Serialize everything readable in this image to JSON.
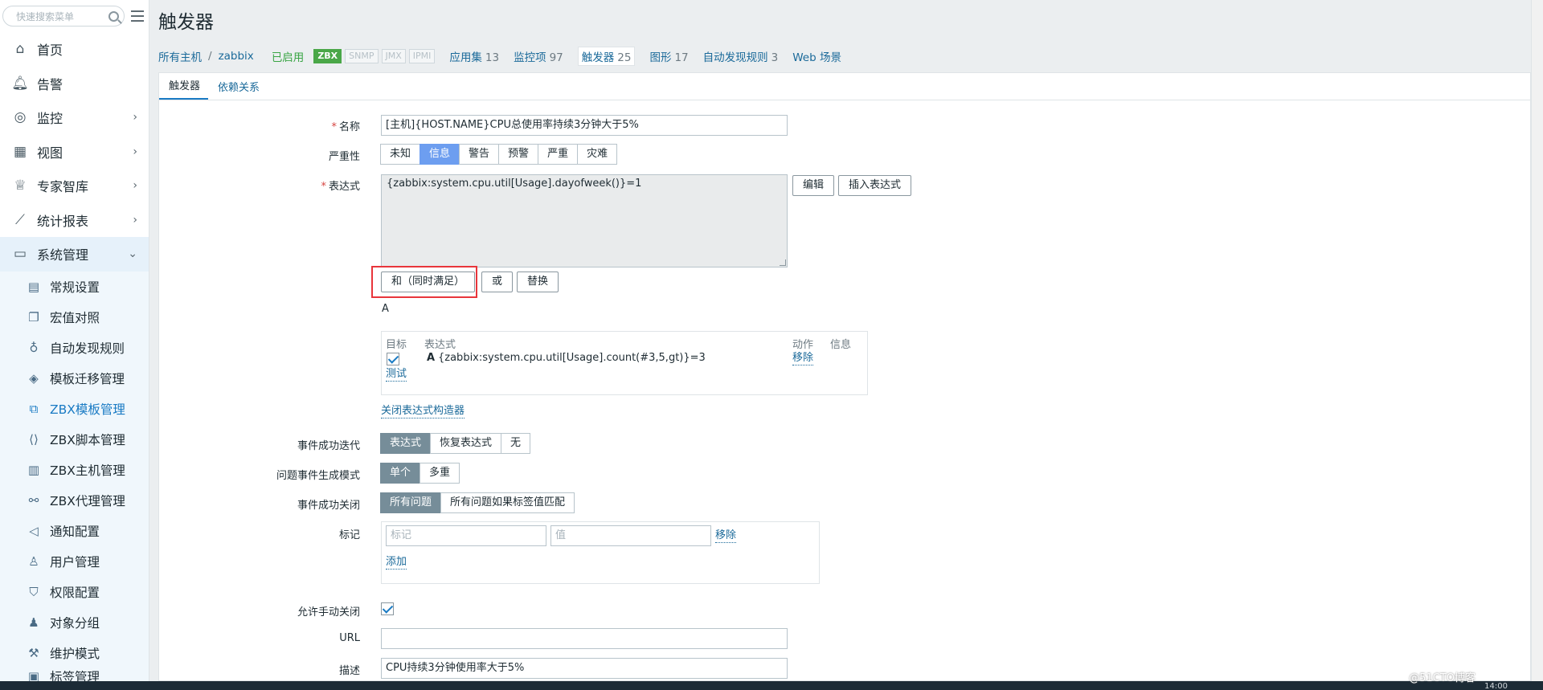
{
  "search": {
    "placeholder": "快速搜索菜单"
  },
  "menu": {
    "items": [
      {
        "label": "首页",
        "icon": "home-icon"
      },
      {
        "label": "告警",
        "icon": "bell-icon"
      },
      {
        "label": "监控",
        "icon": "monitor-eye-icon",
        "arrow": "›"
      },
      {
        "label": "视图",
        "icon": "grid-icon",
        "arrow": "›"
      },
      {
        "label": "专家智库",
        "icon": "graduation-cap-icon",
        "arrow": "›"
      },
      {
        "label": "统计报表",
        "icon": "line-chart-icon",
        "arrow": "›"
      },
      {
        "label": "系统管理",
        "icon": "desktop-icon",
        "arrow": "⌄"
      }
    ],
    "sub_items": [
      {
        "label": "常规设置",
        "icon": "calendar-icon"
      },
      {
        "label": "宏值对照",
        "icon": "copy-icon"
      },
      {
        "label": "自动发现规则",
        "icon": "bulb-icon"
      },
      {
        "label": "模板迁移管理",
        "icon": "layers-icon"
      },
      {
        "label": "ZBX模板管理",
        "icon": "template-icon"
      },
      {
        "label": "ZBX脚本管理",
        "icon": "code-file-icon"
      },
      {
        "label": "ZBX主机管理",
        "icon": "server-icon"
      },
      {
        "label": "ZBX代理管理",
        "icon": "network-icon"
      },
      {
        "label": "通知配置",
        "icon": "speaker-icon"
      },
      {
        "label": "用户管理",
        "icon": "user-icon"
      },
      {
        "label": "权限配置",
        "icon": "shield-icon"
      },
      {
        "label": "对象分组",
        "icon": "group-icon"
      },
      {
        "label": "维护模式",
        "icon": "tools-icon"
      },
      {
        "label": "标签管理",
        "icon": "tag-icon"
      }
    ]
  },
  "page": {
    "title": "触发器"
  },
  "breadcrumb": {
    "all_hosts": "所有主机",
    "separator": "/",
    "host": "zabbix",
    "status": "已启用"
  },
  "badges": {
    "zbx": "ZBX",
    "snmp": "SNMP",
    "jmx": "JMX",
    "ipmi": "IPMI"
  },
  "nav_links": [
    {
      "label": "应用集",
      "count": "13"
    },
    {
      "label": "监控项",
      "count": "97"
    },
    {
      "label": "触发器",
      "count": "25"
    },
    {
      "label": "图形",
      "count": "17"
    },
    {
      "label": "自动发现规则",
      "count": "3"
    },
    {
      "label": "Web 场景",
      "count": ""
    }
  ],
  "tabs": {
    "trigger": "触发器",
    "dependencies": "依赖关系"
  },
  "form": {
    "name_label": "名称",
    "name_value": "[主机]{HOST.NAME}CPU总使用率持续3分钟大于5%",
    "severity_label": "严重性",
    "severity_options": [
      "未知",
      "信息",
      "警告",
      "预警",
      "严重",
      "灾难"
    ],
    "expression_label": "表达式",
    "expression_value": "{zabbix:system.cpu.util[Usage].dayofweek()}=1",
    "edit_button": "编辑",
    "insert_expression_button": "插入表达式",
    "and_button": "和（同时满足）",
    "or_button": "或",
    "replace_button": "替换",
    "expr_letter": "A",
    "builder": {
      "col_target": "目标",
      "col_expression": "表达式",
      "col_action": "动作",
      "col_info": "信息",
      "row_letter": "A",
      "row_expression": "{zabbix:system.cpu.util[Usage].count(#3,5,gt)}=3",
      "remove_link": "移除",
      "test_link": "测试"
    },
    "close_builder_link": "关闭表达式构造器",
    "ok_event_gen_label": "事件成功迭代",
    "ok_event_gen_options": [
      "表达式",
      "恢复表达式",
      "无"
    ],
    "problem_mode_label": "问题事件生成模式",
    "problem_mode_options": [
      "单个",
      "多重"
    ],
    "ok_close_label": "事件成功关闭",
    "ok_close_options": [
      "所有问题",
      "所有问题如果标签值匹配"
    ],
    "tags_label": "标记",
    "tag_placeholder": "标记",
    "value_placeholder": "值",
    "tag_remove_link": "移除",
    "tag_add_link": "添加",
    "manual_close_label": "允许手动关闭",
    "url_label": "URL",
    "url_value": "",
    "description_label": "描述",
    "description_value": "CPU持续3分钟使用率大于5%"
  },
  "watermark": "@51CTO博客",
  "clock": "14:00",
  "colors": {
    "accent": "#1a7bc4",
    "selected_blue": "#6d9ef0",
    "selected_grey": "#768d99",
    "enabled_green": "#3aa545",
    "highlight_red": "#e8353b"
  }
}
